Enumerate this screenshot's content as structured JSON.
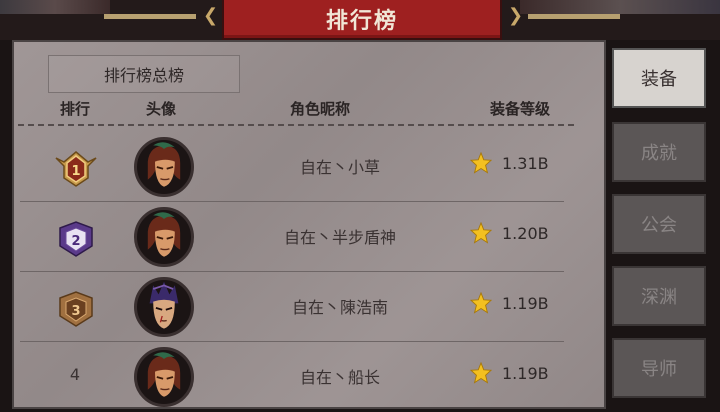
{
  "title": "排行榜",
  "subtab": "排行榜总榜",
  "columns": {
    "rank": "排行",
    "avatar": "头像",
    "name": "角色昵称",
    "level": "装备等级"
  },
  "rows": [
    {
      "rank": "1",
      "name": "自在丶小草",
      "level": "1.31B",
      "badge": "gold",
      "avatar": "brown-hair-green-cap-icon"
    },
    {
      "rank": "2",
      "name": "自在丶半步盾神",
      "level": "1.20B",
      "badge": "purple",
      "avatar": "brown-hair-green-cap-icon"
    },
    {
      "rank": "3",
      "name": "自在丶陳浩南",
      "level": "1.19B",
      "badge": "bronze",
      "avatar": "purple-spiky-hair-icon"
    },
    {
      "rank": "4",
      "name": "自在丶船长",
      "level": "1.19B",
      "badge": "",
      "avatar": "brown-hair-green-cap-icon"
    }
  ],
  "sidebar": [
    {
      "label": "装备",
      "active": true
    },
    {
      "label": "成就",
      "active": false
    },
    {
      "label": "公会",
      "active": false
    },
    {
      "label": "深渊",
      "active": false
    },
    {
      "label": "导师",
      "active": false
    }
  ],
  "colors": {
    "banner": "#9e2020",
    "panel": "#9a9090",
    "gold": "#b7a070",
    "star": "#f3c020"
  }
}
